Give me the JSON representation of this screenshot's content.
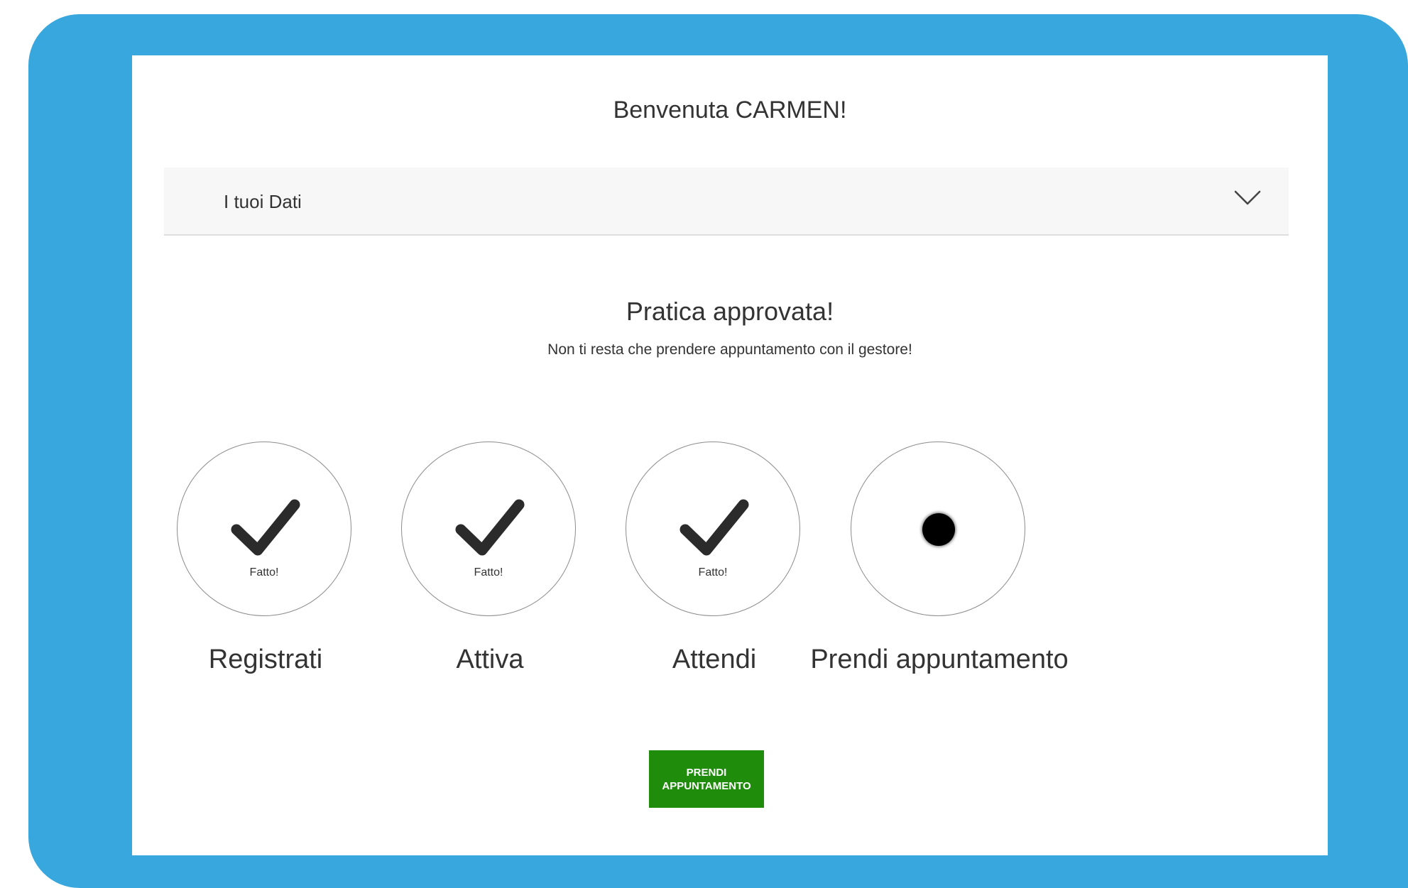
{
  "header": {
    "welcome": "Benvenuta CARMEN!"
  },
  "accordion": {
    "label": "I tuoi Dati",
    "icon": "chevron-down-icon"
  },
  "status": {
    "title": "Pratica approvata!",
    "subtitle": "Non ti resta che prendere appuntamento con il gestore!"
  },
  "steps": [
    {
      "label": "Registrati",
      "done_text": "Fatto!",
      "state": "done",
      "icon": "checkmark-icon"
    },
    {
      "label": "Attiva",
      "done_text": "Fatto!",
      "state": "done",
      "icon": "checkmark-icon"
    },
    {
      "label": "Attendi",
      "done_text": "Fatto!",
      "state": "done",
      "icon": "checkmark-icon"
    },
    {
      "label": "Prendi appuntamento",
      "state": "current",
      "icon": "dot-icon"
    }
  ],
  "cta": {
    "label_line1": "PRENDI",
    "label_line2": "APPUNTAMENTO"
  },
  "colors": {
    "frame": "#37a7dd",
    "cta": "#1f8c0b",
    "text": "#333333"
  }
}
